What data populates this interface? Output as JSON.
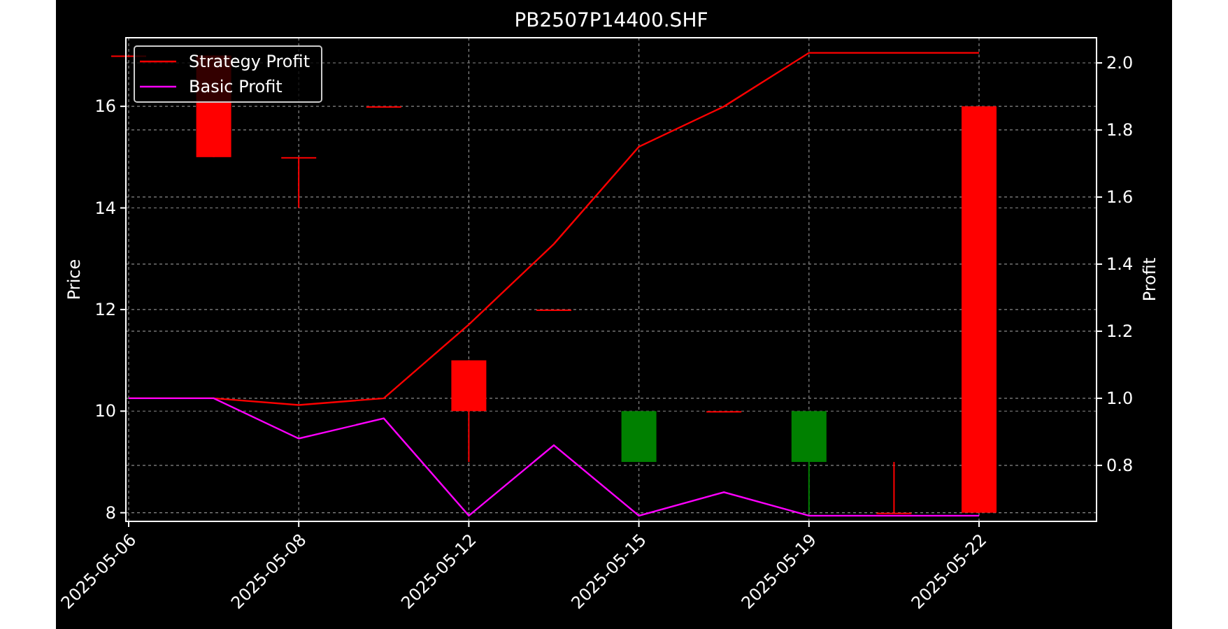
{
  "chart_data": {
    "type": "line",
    "title": "PB2507P14400.SHF",
    "ylabel": "Price",
    "y2label": "Profit",
    "categories": [
      "2025-05-06",
      null,
      "2025-05-08",
      null,
      "2025-05-12",
      null,
      "2025-05-15",
      null,
      "2025-05-19",
      null,
      "2025-05-22"
    ],
    "ylim": [
      7.83,
      17.35
    ],
    "yticks": [
      8,
      10,
      12,
      14,
      16
    ],
    "y2lim": [
      0.633,
      2.075
    ],
    "y2ticks": [
      {
        "value": 0.8,
        "label": "0.8"
      },
      {
        "value": 1.0,
        "label": "1.0"
      },
      {
        "value": 1.2,
        "label": "1.2"
      },
      {
        "value": 1.4,
        "label": "1.4"
      },
      {
        "value": 1.6,
        "label": "1.6"
      },
      {
        "value": 1.8,
        "label": "1.8"
      },
      {
        "value": 2.0,
        "label": "2.0"
      }
    ],
    "grid": true,
    "legend": true,
    "series": [
      {
        "name": "Strategy Profit",
        "color": "#ff0000",
        "axis": "y2",
        "values": [
          1.0,
          1.0,
          0.98,
          1.0,
          1.22,
          1.46,
          1.75,
          1.87,
          2.03,
          2.03,
          2.03
        ]
      },
      {
        "name": "Basic Profit",
        "color": "#ff00ff",
        "axis": "y2",
        "values": [
          1.0,
          1.0,
          0.88,
          0.94,
          0.65,
          0.86,
          0.65,
          0.72,
          0.65,
          0.65,
          0.65
        ]
      }
    ]
  }
}
